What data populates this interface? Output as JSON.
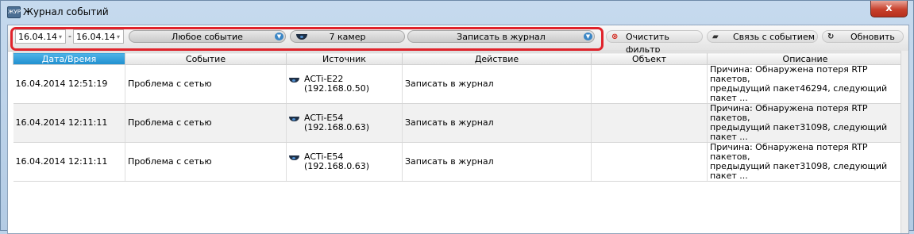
{
  "window": {
    "title": "Журнал событий",
    "icon_text": "ЖУР",
    "close_glyph": "x"
  },
  "filters": {
    "date_from": "16.04.14",
    "date_sep": "-",
    "date_to": "16.04.14",
    "event_type": "Любое событие",
    "cameras": "7 камер",
    "action": "Записать в журнал"
  },
  "toolbar": {
    "clear_filter": "Очистить фильтр",
    "link_event": "Связь с событием",
    "refresh": "Обновить"
  },
  "table": {
    "columns": [
      "Дата/Время",
      "Событие",
      "Источник",
      "Действие",
      "Объект",
      "Описание"
    ],
    "sorted_column": "Дата/Время",
    "rows": [
      {
        "datetime": "16.04.2014 12:51:19",
        "event": "Проблема с сетью",
        "source_name": "ACTi-E22",
        "source_ip": "(192.168.0.50)",
        "action": "Записать в журнал",
        "object": "",
        "desc_line1": "Причина: Обнаружена потеря RTP пакетов,",
        "desc_line2": "предыдущий пакет46294, следующий пакет ..."
      },
      {
        "datetime": "16.04.2014 12:11:11",
        "event": "Проблема с сетью",
        "source_name": "ACTi-E54",
        "source_ip": "(192.168.0.63)",
        "action": "Записать в журнал",
        "object": "",
        "desc_line1": "Причина: Обнаружена потеря RTP пакетов,",
        "desc_line2": "предыдущий пакет31098, следующий пакет ..."
      },
      {
        "datetime": "16.04.2014 12:11:11",
        "event": "Проблема с сетью",
        "source_name": "ACTi-E54",
        "source_ip": "(192.168.0.63)",
        "action": "Записать в журнал",
        "object": "",
        "desc_line1": "Причина: Обнаружена потеря RTP пакетов,",
        "desc_line2": "предыдущий пакет31098, следующий пакет ..."
      }
    ]
  },
  "icons": {
    "clear": "clear-filter-icon",
    "link": "folder-link-icon",
    "refresh": "refresh-icon",
    "camera": "camera-icon",
    "dropdown": "dropdown-icon"
  },
  "colors": {
    "filter_highlight": "#e0232b",
    "sorted_header": "#2a9ad6",
    "close_button": "#c7402c"
  }
}
